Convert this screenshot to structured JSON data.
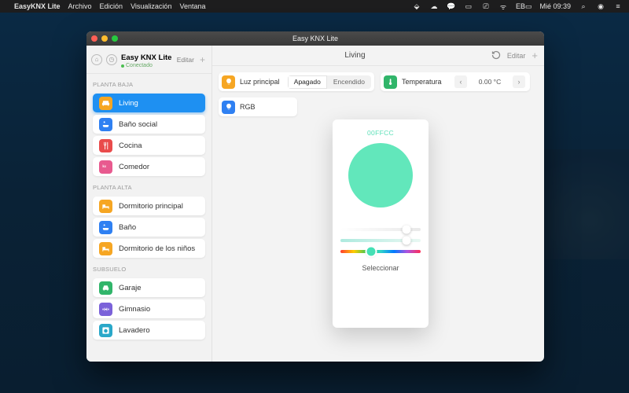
{
  "menubar": {
    "app": "EasyKNX Lite",
    "items": [
      "Archivo",
      "Edición",
      "Visualización",
      "Ventana"
    ],
    "clock": "Mié 09:39",
    "battery": "EB"
  },
  "window": {
    "title": "Easy KNX Lite"
  },
  "sidebar": {
    "title": "Easy KNX Lite",
    "status": "Conectado",
    "edit": "Editar",
    "groups": [
      {
        "label": "PLANTA BAJA",
        "rooms": [
          {
            "name": "Living",
            "color": "c-or",
            "icon": "sofa",
            "active": true
          },
          {
            "name": "Baño social",
            "color": "c-bl",
            "icon": "bath"
          },
          {
            "name": "Cocina",
            "color": "c-rd",
            "icon": "fork"
          },
          {
            "name": "Comedor",
            "color": "c-pk",
            "icon": "knx"
          }
        ]
      },
      {
        "label": "PLANTA ALTA",
        "rooms": [
          {
            "name": "Dormitorio principal",
            "color": "c-or",
            "icon": "bed"
          },
          {
            "name": "Baño",
            "color": "c-bl",
            "icon": "bath"
          },
          {
            "name": "Dormitorio de los niños",
            "color": "c-or",
            "icon": "bed"
          }
        ]
      },
      {
        "label": "SUBSUELO",
        "rooms": [
          {
            "name": "Garaje",
            "color": "c-gr",
            "icon": "car"
          },
          {
            "name": "Gimnasio",
            "color": "c-pu",
            "icon": "gym"
          },
          {
            "name": "Lavadero",
            "color": "c-cy",
            "icon": "wash"
          }
        ]
      }
    ]
  },
  "main": {
    "title": "Living",
    "edit": "Editar",
    "luz": {
      "label": "Luz principal",
      "off": "Apagado",
      "on": "Encendido",
      "state": "off"
    },
    "rgb": {
      "label": "RGB"
    },
    "temp": {
      "label": "Temperatura",
      "value": "0.00 °C"
    }
  },
  "picker": {
    "hex": "00FFCC",
    "color": "#62e7bb",
    "knobA": 82,
    "knobB": 82,
    "knobC": 38,
    "select": "Seleccionar"
  }
}
